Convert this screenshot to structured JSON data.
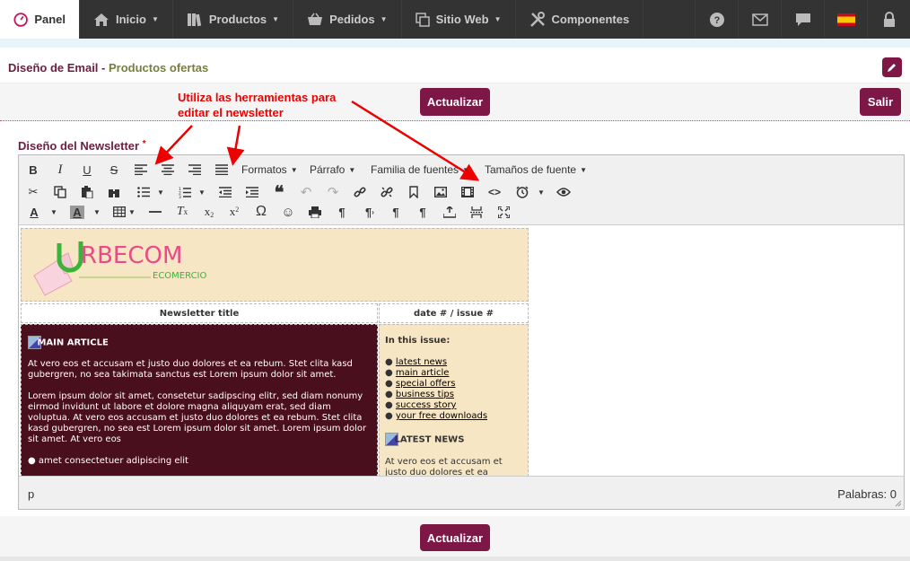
{
  "nav": {
    "panel": "Panel",
    "inicio": "Inicio",
    "productos": "Productos",
    "pedidos": "Pedidos",
    "sitio_web": "Sitio Web",
    "componentes": "Componentes",
    "language_flag": "es-flag"
  },
  "page": {
    "title": "Diseño de Email -",
    "subtitle": "Productos ofertas"
  },
  "actions": {
    "update": "Actualizar",
    "exit": "Salir"
  },
  "annotation": {
    "line1": "Utiliza las herramientas para",
    "line2": "editar el newsletter"
  },
  "field": {
    "label": "Diseño del Newsletter",
    "required": "*"
  },
  "toolbar": {
    "formats": "Formatos",
    "paragraph": "Párrafo",
    "font_family": "Familia de fuentes",
    "font_sizes": "Tamaños de fuente"
  },
  "newsletter": {
    "logo_text": "RBECOM",
    "logo_sub": "ECOMERCIO",
    "title": "Newsletter title",
    "date_issue": "date # / issue #",
    "main_heading": "MAIN ARTICLE",
    "main_p1": "At vero eos et accusam et justo duo dolores et ea rebum. Stet clita kasd gubergren, no sea takimata sanctus est Lorem ipsum dolor sit amet.",
    "main_p2": "Lorem ipsum dolor sit amet, consetetur sadipscing elitr, sed diam nonumy eirmod invidunt ut labore et dolore magna aliquyam erat, sed diam voluptua. At vero eos accusam et justo duo dolores et ea rebum. Stet clita kasd gubergren, no sea est Lorem ipsum dolor sit amet. Lorem ipsum dolor sit amet. At vero eos",
    "main_bullet": "amet consectetuer adipiscing elit",
    "in_this_issue": "In this issue:",
    "links": [
      "latest news",
      "main article",
      "special offers",
      "business tips",
      "success story",
      "your free downloads"
    ],
    "latest_heading": "LATEST NEWS",
    "latest_p": "At vero eos et accusam et justo duo dolores et ea"
  },
  "status": {
    "path": "p",
    "word_count": "Palabras: 0"
  },
  "colors": {
    "brand": "#7d1745",
    "nav_bg": "#333333",
    "accent_red": "#e00000"
  }
}
